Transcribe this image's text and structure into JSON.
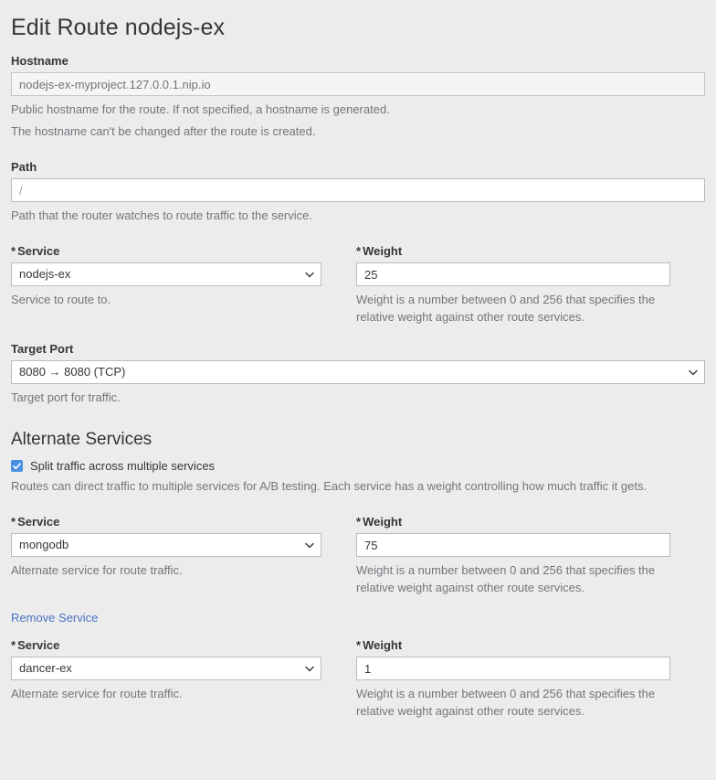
{
  "page": {
    "title": "Edit Route nodejs-ex"
  },
  "hostname": {
    "label": "Hostname",
    "value": "nodejs-ex-myproject.127.0.0.1.nip.io",
    "help_1": "Public hostname for the route. If not specified, a hostname is generated.",
    "help_2": "The hostname can't be changed after the route is created."
  },
  "path": {
    "label": "Path",
    "value": "",
    "placeholder": "/",
    "help": "Path that the router watches to route traffic to the service."
  },
  "primary_service": {
    "service_label": "Service",
    "service_value": "nodejs-ex",
    "service_help": "Service to route to.",
    "weight_label": "Weight",
    "weight_value": "25",
    "weight_help": "Weight is a number between 0 and 256 that specifies the relative weight against other route services.",
    "required_marker": "*"
  },
  "target_port": {
    "label": "Target Port",
    "value": "8080 → 8080 (TCP)",
    "help": "Target port for traffic."
  },
  "alternate_services": {
    "heading": "Alternate Services",
    "split_checkbox_label": "Split traffic across multiple services",
    "split_checked": true,
    "description": "Routes can direct traffic to multiple services for A/B testing. Each service has a weight controlling how much traffic it gets.",
    "remove_label": "Remove Service",
    "required_marker": "*",
    "service_label": "Service",
    "weight_label": "Weight",
    "service_help": "Alternate service for route traffic.",
    "weight_help": "Weight is a number between 0 and 256 that specifies the relative weight against other route services.",
    "items": [
      {
        "service_value": "mongodb",
        "weight_value": "75",
        "has_remove": true
      },
      {
        "service_value": "dancer-ex",
        "weight_value": "1",
        "has_remove": false
      }
    ]
  },
  "colors": {
    "page_background": "#ececec",
    "accent_blue": "#4a90e2",
    "link_blue": "#4a72c4",
    "text": "#363636",
    "help_text": "#72767b"
  },
  "icons": {
    "chevron": "chevron-down-icon",
    "check": "check-icon"
  }
}
